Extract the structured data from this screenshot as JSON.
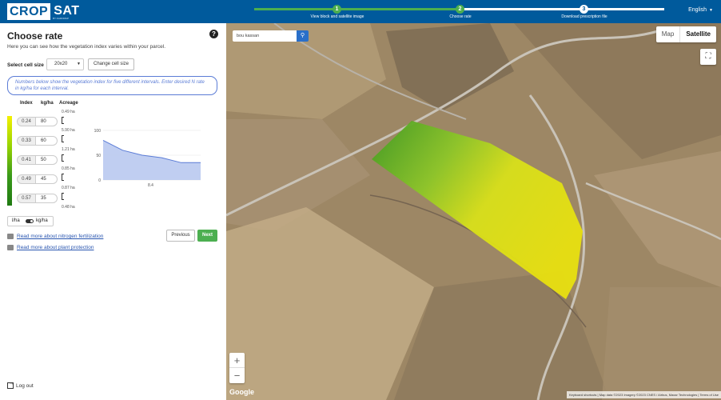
{
  "brand": {
    "crop": "CROP",
    "sat": "SAT",
    "sub": "BY AGROMAP"
  },
  "steps": [
    {
      "num": "1",
      "label": "View block and satellite image",
      "color": "#4caf50"
    },
    {
      "num": "2",
      "label": "Choose rate",
      "color": "#4caf50"
    },
    {
      "num": "3",
      "label": "Download prescription file",
      "color": "#ffffff"
    }
  ],
  "language": "English",
  "panel": {
    "title": "Choose rate",
    "subtitle": "Here you can see how the vegetation index varies within your parcel.",
    "cell_size_label": "Select cell size",
    "cell_size_value": "20x20",
    "change_cell_button": "Change cell size",
    "info": "Numbers below show the vegetation index for five different intervals. Enter desired N rate in kg/ha for each interval.",
    "headers": {
      "index": "Index",
      "rate": "kg/ha",
      "acreage": "Acreage"
    },
    "intervals": [
      {
        "index": "0.24",
        "rate": "80",
        "acreage_top": "0.49 ha",
        "acreage_bottom": "5.90 ha"
      },
      {
        "index": "0.33",
        "rate": "60",
        "acreage": "1.21 ha"
      },
      {
        "index": "0.41",
        "rate": "50",
        "acreage": "0.85 ha"
      },
      {
        "index": "0.49",
        "rate": "45",
        "acreage": "0.87 ha"
      },
      {
        "index": "0.57",
        "rate": "35",
        "acreage": "0.48 ha"
      }
    ],
    "unit_a": "l/ha",
    "unit_b": "kg/ha",
    "link_nitrogen": "Read more about nitrogen fertilization",
    "link_plant": "Read more about plant protection",
    "prev_button": "Previous",
    "next_button": "Next",
    "logout": "Log out"
  },
  "chart_data": {
    "type": "area",
    "x": [
      0,
      1,
      2,
      3,
      4,
      5
    ],
    "values": [
      80,
      60,
      50,
      45,
      35,
      35
    ],
    "ylim": [
      0,
      100
    ],
    "yticks": [
      "100",
      "50",
      "0"
    ],
    "xtick": "8.4",
    "color": "#5b7cd6"
  },
  "map": {
    "search_value": "bou kassan",
    "map_label": "Map",
    "satellite_label": "Satellite",
    "google": "Google",
    "attribution": "Keyboard shortcuts | Map data ©2023 Imagery ©2023 CNES / Airbus, Maxar Technologies | Terms of Use"
  }
}
